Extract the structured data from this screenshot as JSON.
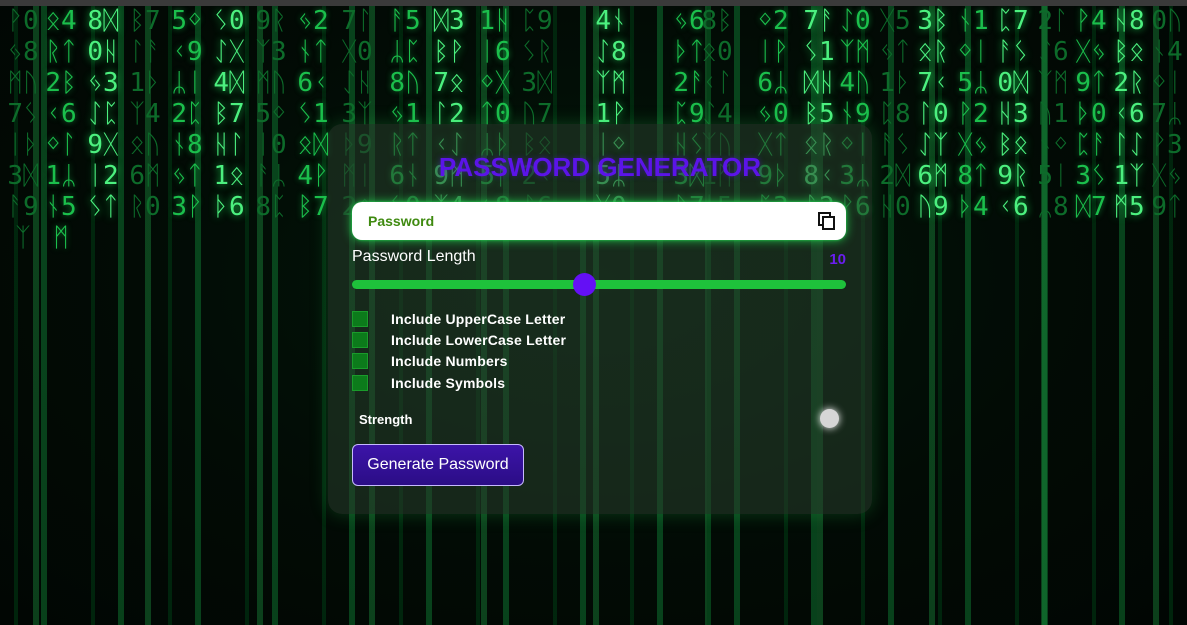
{
  "card": {
    "title": "PASSWORD GENERATOR",
    "password_placeholder": "Password",
    "length_label": "Password Length",
    "length_value": "10",
    "length_level": 0.47,
    "options": [
      {
        "label": "Include UpperCase Letter",
        "checked": false
      },
      {
        "label": "Include LowerCase Letter",
        "checked": false
      },
      {
        "label": "Include Numbers",
        "checked": false
      },
      {
        "label": "Include Symbols",
        "checked": false
      }
    ],
    "strength_label": "Strength",
    "generate_label": "Generate Password",
    "icons": {
      "copy": "copy-icon"
    }
  },
  "colors": {
    "accent": "#5b14e8",
    "slider": "#1ec23b",
    "checkbox": "#0c7b1b",
    "button": "#2b0d86"
  }
}
